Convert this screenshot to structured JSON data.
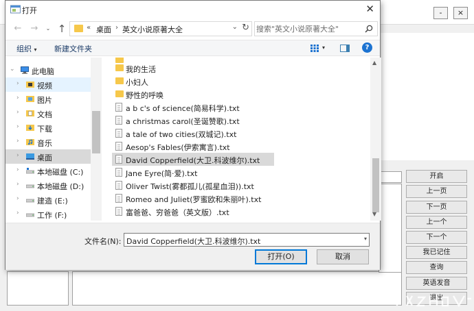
{
  "background_app": {
    "window_controls": [
      "-",
      "×"
    ],
    "buttons": [
      "开启",
      "上一页",
      "下一页",
      "上一个",
      "下一个",
      "我已记住",
      "查询",
      "英语发音",
      "退出"
    ]
  },
  "dialog": {
    "title": "打开",
    "address": {
      "breadcrumbs": [
        "桌面",
        "英文小说原著大全"
      ]
    },
    "search_placeholder": "搜索\"英文小说原著大全\"",
    "toolbar": {
      "organize": "组织",
      "new_folder": "新建文件夹"
    },
    "tree": [
      {
        "label": "此电脑",
        "icon": "computer-icon"
      },
      {
        "label": "视频",
        "icon": "video-folder-icon"
      },
      {
        "label": "图片",
        "icon": "pictures-folder-icon"
      },
      {
        "label": "文档",
        "icon": "documents-folder-icon"
      },
      {
        "label": "下载",
        "icon": "downloads-folder-icon"
      },
      {
        "label": "音乐",
        "icon": "music-folder-icon"
      },
      {
        "label": "桌面",
        "icon": "desktop-folder-icon"
      },
      {
        "label": "本地磁盘 (C:)",
        "icon": "drive-icon"
      },
      {
        "label": "本地磁盘 (D:)",
        "icon": "drive-icon"
      },
      {
        "label": "建造 (E:)",
        "icon": "drive-icon"
      },
      {
        "label": "工作 (F:)",
        "icon": "drive-icon"
      }
    ],
    "files": [
      {
        "name": "我的生活",
        "type": "folder"
      },
      {
        "name": "小妇人",
        "type": "folder"
      },
      {
        "name": "野性的呼唤",
        "type": "folder"
      },
      {
        "name": "a b c's of science(简易科学).txt",
        "type": "txt"
      },
      {
        "name": "a christmas carol(圣诞赞歌).txt",
        "type": "txt"
      },
      {
        "name": "a tale of two cities(双城记).txt",
        "type": "txt"
      },
      {
        "name": "Aesop's Fables(伊索寓言).txt",
        "type": "txt"
      },
      {
        "name": "David Copperfield(大卫.科波维尔).txt",
        "type": "txt",
        "selected": true
      },
      {
        "name": "Jane Eyre(简·爱).txt",
        "type": "txt"
      },
      {
        "name": "Oliver Twist(雾都孤儿(孤星血泪)).txt",
        "type": "txt"
      },
      {
        "name": "Romeo and Juliet(罗蜜欧和朱丽叶).txt",
        "type": "txt"
      },
      {
        "name": "富爸爸、穷爸爸（英文版）.txt",
        "type": "txt"
      }
    ],
    "filename": {
      "label": "文件名(N):",
      "value": "David Copperfield(大卫.科波维尔).txt"
    },
    "open_label": "打开(O)",
    "cancel_label": "取消"
  },
  "colors": {
    "selection": "#d9d9d9",
    "hover": "#e5f3ff",
    "folder": "#f6c84b",
    "accent": "#0078d7"
  }
}
